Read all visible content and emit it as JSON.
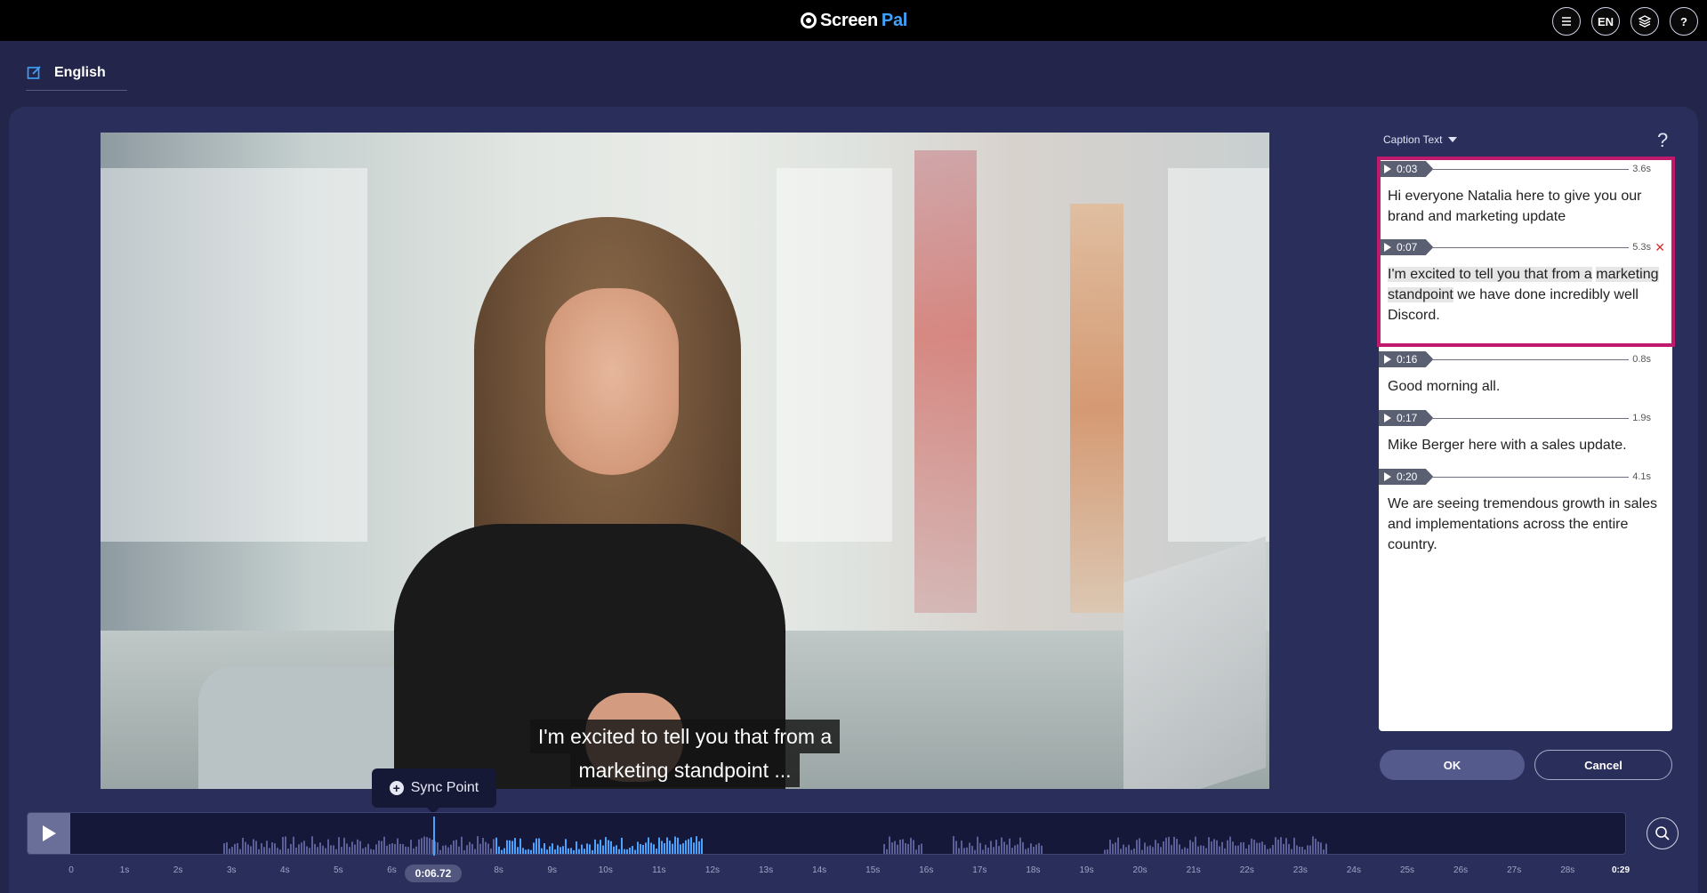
{
  "header": {
    "logo_screen": "Screen",
    "logo_pal": "Pal",
    "menu_icon": "hamburger-menu-icon",
    "language_button": "EN",
    "layers_icon": "layers-icon",
    "help_label": "?"
  },
  "language_tab": {
    "label": "English",
    "icon": "edit-icon"
  },
  "video": {
    "subtitle_line1": "I'm excited to tell you that from a",
    "subtitle_line2": "marketing standpoint ..."
  },
  "sync_point": {
    "label": "Sync Point"
  },
  "captions": {
    "header_label": "Caption Text",
    "help_label": "?",
    "items": [
      {
        "time": "0:03",
        "duration": "3.6s",
        "text": "Hi everyone Natalia here to give you our brand and marketing update"
      },
      {
        "time": "0:07",
        "duration": "5.3s",
        "text_sel1": "I'm excited to tell you that from a",
        "text_sel2": "marketing standpoint",
        "text_rest": " we have done incredibly well Discord."
      },
      {
        "time": "0:16",
        "duration": "0.8s",
        "text": "Good morning all."
      },
      {
        "time": "0:17",
        "duration": "1.9s",
        "text": "Mike Berger here with a sales update."
      },
      {
        "time": "0:20",
        "duration": "4.1s",
        "text": "We are seeing tremendous growth in sales and implementations across the entire country."
      }
    ],
    "ok_label": "OK",
    "cancel_label": "Cancel"
  },
  "timeline": {
    "current_time": "0:06.72",
    "ticks": [
      "0",
      "1s",
      "2s",
      "3s",
      "4s",
      "5s",
      "6s",
      "7s",
      "8s",
      "9s",
      "10s",
      "11s",
      "12s",
      "13s",
      "14s",
      "15s",
      "16s",
      "17s",
      "18s",
      "19s",
      "20s",
      "21s",
      "22s",
      "23s",
      "24s",
      "25s",
      "26s",
      "27s",
      "28s",
      "0:29"
    ]
  },
  "colors": {
    "accent": "#3fa2ff",
    "highlight": "#c01a6e",
    "background": "#23264a"
  }
}
